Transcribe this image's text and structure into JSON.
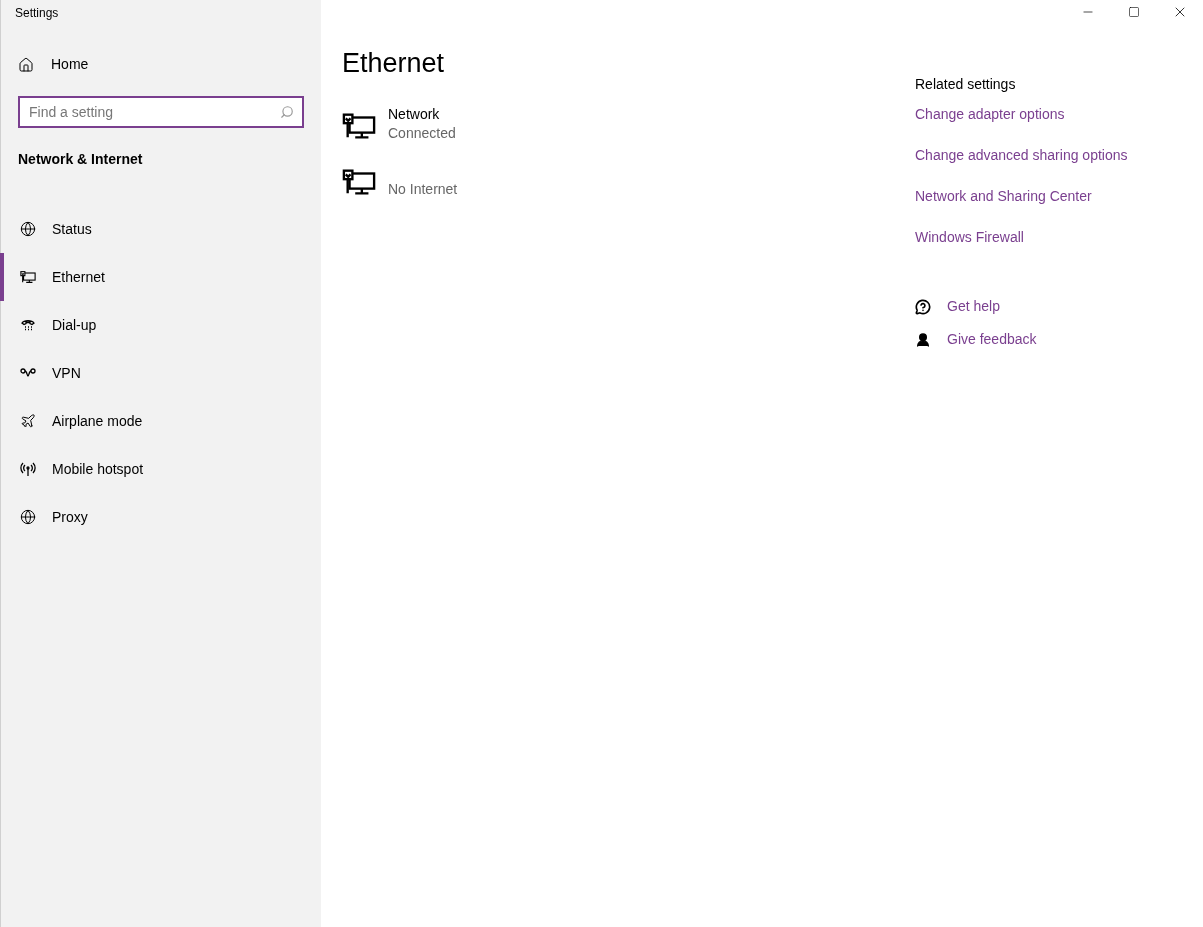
{
  "window": {
    "title": "Settings"
  },
  "sidebar": {
    "home": "Home",
    "search": {
      "placeholder": "Find a setting"
    },
    "category": "Network & Internet",
    "items": [
      {
        "kind": "status",
        "label": "Status",
        "selected": false
      },
      {
        "kind": "ethernet",
        "label": "Ethernet",
        "selected": true
      },
      {
        "kind": "dialup",
        "label": "Dial-up",
        "selected": false
      },
      {
        "kind": "vpn",
        "label": "VPN",
        "selected": false
      },
      {
        "kind": "airplane",
        "label": "Airplane mode",
        "selected": false
      },
      {
        "kind": "hotspot",
        "label": "Mobile hotspot",
        "selected": false
      },
      {
        "kind": "proxy",
        "label": "Proxy",
        "selected": false
      }
    ]
  },
  "page": {
    "title": "Ethernet",
    "networks": [
      {
        "name": "Network",
        "status": "Connected"
      },
      {
        "status": "No Internet"
      }
    ]
  },
  "related": {
    "heading": "Related settings",
    "links": [
      "Change adapter options",
      "Change advanced sharing options",
      "Network and Sharing Center",
      "Windows Firewall"
    ]
  },
  "help": [
    {
      "kind": "help",
      "label": "Get help"
    },
    {
      "kind": "feedback",
      "label": "Give feedback"
    }
  ]
}
